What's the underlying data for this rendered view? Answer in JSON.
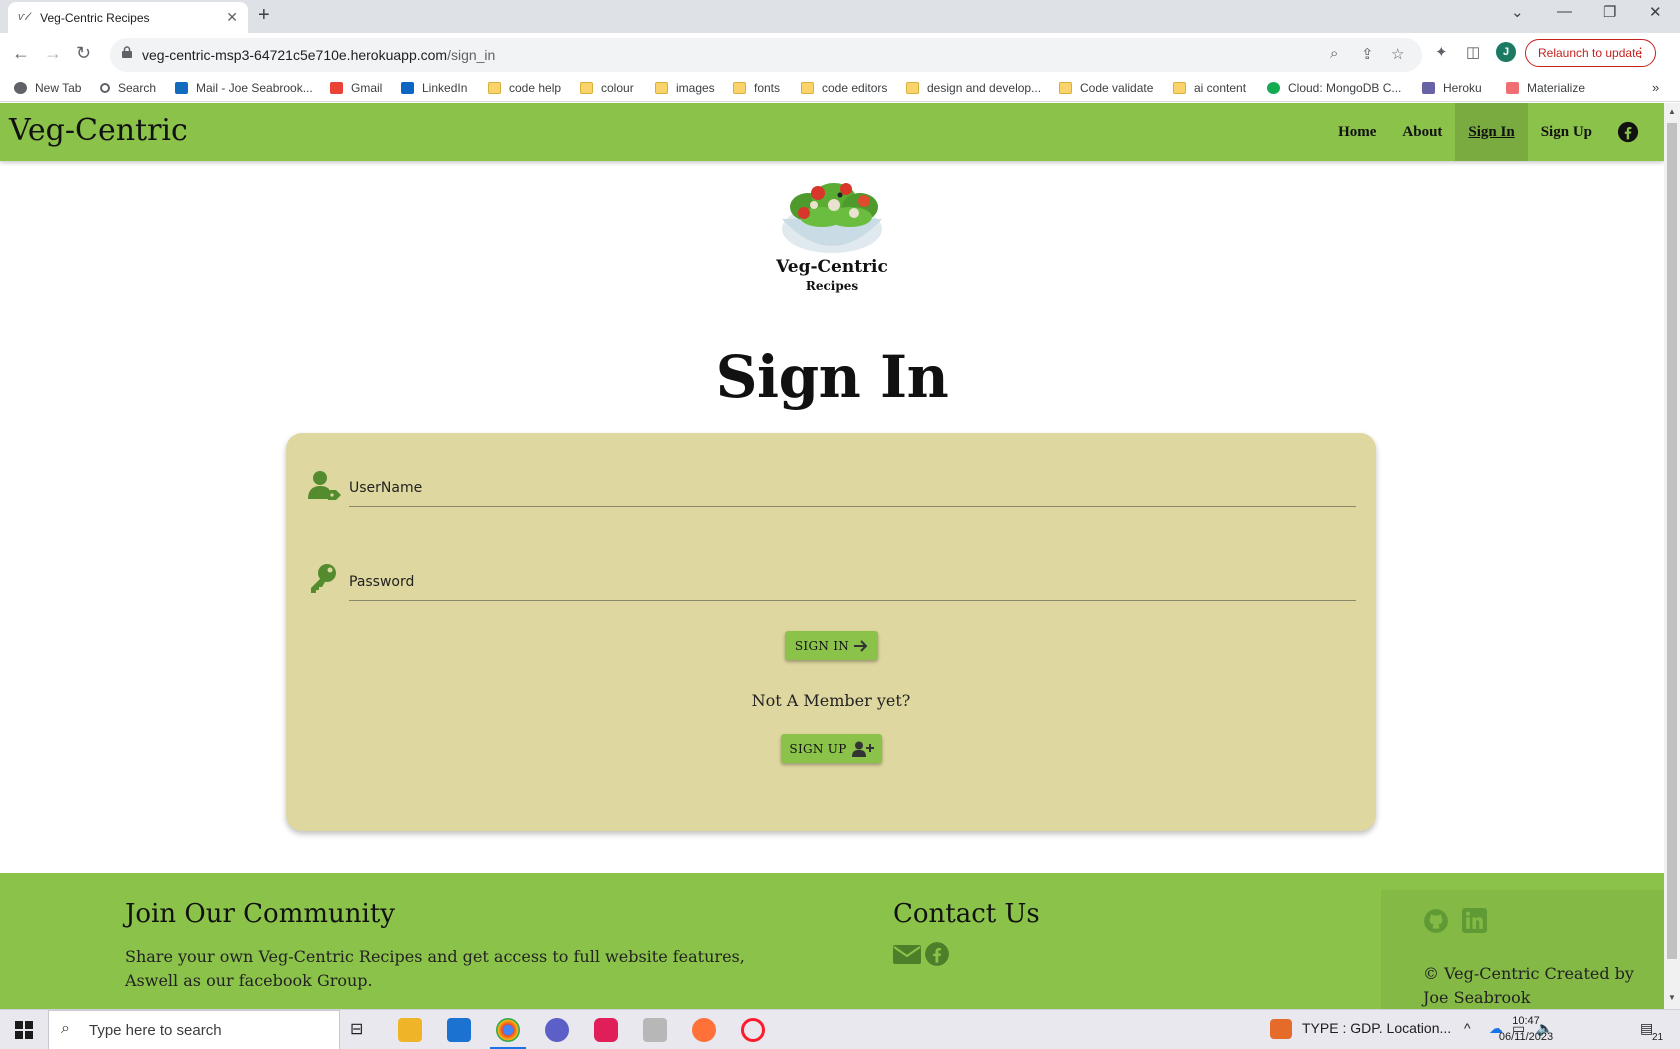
{
  "browser": {
    "tab_title": "Veg-Centric Recipes",
    "url_host": "veg-centric-msp3-64721c5e710e.herokuapp.com",
    "url_path": "/sign_in",
    "relaunch_label": "Relaunch to update",
    "profile_initial": "J"
  },
  "bookmarks": [
    {
      "label": "New Tab",
      "icon": "globe-icon"
    },
    {
      "label": "Search",
      "icon": "search-icon"
    },
    {
      "label": "Mail - Joe Seabrook...",
      "icon": "outlook-icon"
    },
    {
      "label": "Gmail",
      "icon": "gmail-icon"
    },
    {
      "label": "LinkedIn",
      "icon": "linkedin-icon"
    },
    {
      "label": "code help",
      "icon": "folder-icon"
    },
    {
      "label": "colour",
      "icon": "folder-icon"
    },
    {
      "label": "images",
      "icon": "folder-icon"
    },
    {
      "label": "fonts",
      "icon": "folder-icon"
    },
    {
      "label": "code editors",
      "icon": "folder-icon"
    },
    {
      "label": "design and develop...",
      "icon": "folder-icon"
    },
    {
      "label": "Code validate",
      "icon": "folder-icon"
    },
    {
      "label": "ai content",
      "icon": "folder-icon"
    },
    {
      "label": "Cloud: MongoDB C...",
      "icon": "mongodb-icon"
    },
    {
      "label": "Heroku",
      "icon": "heroku-icon"
    },
    {
      "label": "Materialize",
      "icon": "materialize-icon"
    }
  ],
  "site": {
    "brand": "Veg-Centric",
    "nav": {
      "home": "Home",
      "about": "About",
      "sign_in": "Sign In",
      "sign_up": "Sign Up"
    },
    "logo_title": "Veg-Centric",
    "logo_subtitle": "Recipes",
    "heading": "Sign In",
    "form": {
      "username_label": "UserName",
      "password_label": "Password",
      "sign_in_button": "SIGN IN",
      "not_member": "Not A Member yet?",
      "sign_up_button": "SIGN UP"
    },
    "footer": {
      "community_title": "Join Our Community",
      "community_text_1": "Share your own Veg-Centric Recipes and get access to full website features,",
      "community_text_2": "Aswell as our facebook Group.",
      "contact_title": "Contact Us",
      "credit_1": "© Veg-Centric Created by",
      "credit_2": "Joe Seabrook"
    },
    "colors": {
      "accent_green": "#8bc34a",
      "card_beige": "#ded79f",
      "icon_green": "#558b2f"
    }
  },
  "taskbar": {
    "search_placeholder": "Type here to search",
    "notification": "TYPE : GDP. Location...",
    "time": "10:47",
    "date": "06/11/2023",
    "notification_count": "21"
  }
}
